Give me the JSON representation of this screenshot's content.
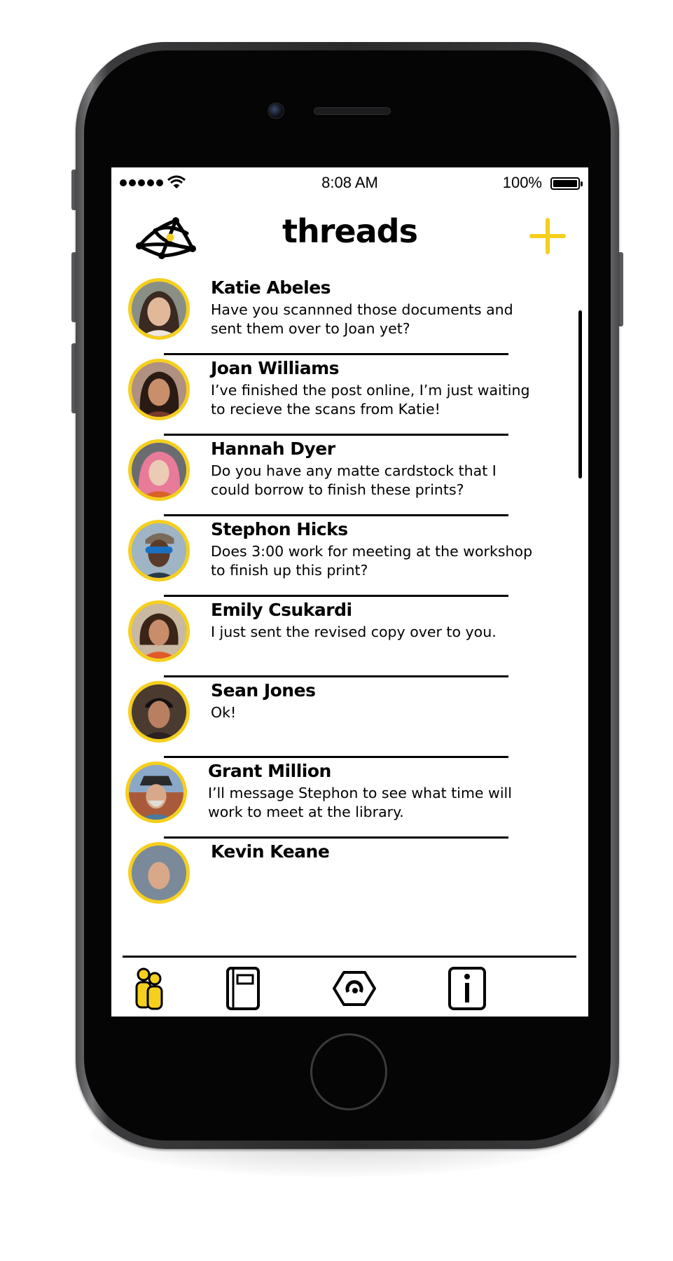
{
  "status_bar": {
    "time": "8:08 AM",
    "battery": "100%"
  },
  "header": {
    "title": "threads",
    "logo_icon": "threads-logo-icon",
    "add_icon": "plus-icon"
  },
  "colors": {
    "accent": "#f5cf1e",
    "text": "#000000",
    "background": "#ffffff"
  },
  "threads": [
    {
      "name": "Katie Abeles",
      "message": "Have you scannned those documents and sent them over to Joan yet?"
    },
    {
      "name": "Joan Williams",
      "message": "I’ve finished the post online, I’m just waiting to recieve the scans from Katie!"
    },
    {
      "name": "Hannah Dyer",
      "message": "Do you have any matte cardstock that I could borrow to finish these prints?"
    },
    {
      "name": "Stephon Hicks",
      "message": "Does 3:00 work for meeting at the workshop to finish up this print?"
    },
    {
      "name": "Emily Csukardi",
      "message": "I just sent the revised copy over to you."
    },
    {
      "name": "Sean Jones",
      "message": "Ok!"
    },
    {
      "name": "Grant Million",
      "message": "I’ll message Stephon to see what time will work to meet at the library."
    },
    {
      "name": "Kevin Keane",
      "message": ""
    }
  ],
  "tabs": [
    {
      "icon": "people-icon",
      "active": true
    },
    {
      "icon": "notebook-icon",
      "active": false
    },
    {
      "icon": "hexagon-camera-icon",
      "active": false
    },
    {
      "icon": "info-icon",
      "active": false
    }
  ]
}
